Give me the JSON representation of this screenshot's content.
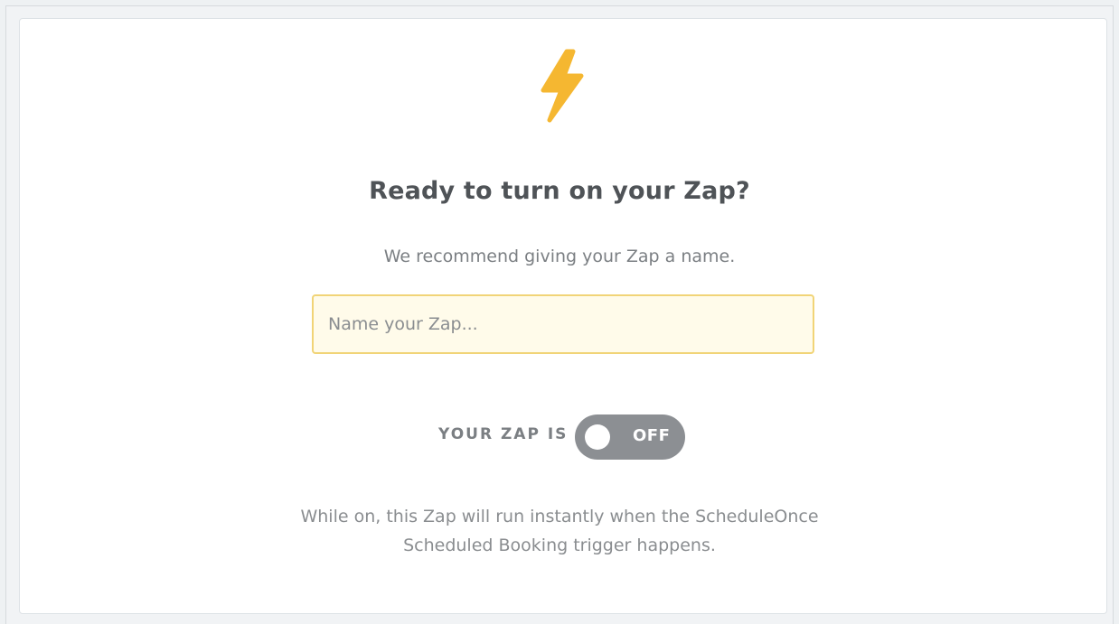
{
  "icon": {
    "name": "lightning-bolt-icon",
    "color": "#f5b731"
  },
  "header": {
    "title": "Ready to turn on your Zap?"
  },
  "recommendation": {
    "text": "We recommend giving your Zap a name."
  },
  "zap_name_input": {
    "value": "",
    "placeholder": "Name your Zap..."
  },
  "status": {
    "label": "YOUR ZAP IS",
    "toggle_state": "OFF",
    "toggle_color": "#8c8f93"
  },
  "footer": {
    "line1": "While on, this Zap will run instantly when the ScheduleOnce",
    "line2": "Scheduled Booking trigger happens."
  },
  "colors": {
    "input_background": "#fffbea",
    "input_border": "#f1d477"
  }
}
